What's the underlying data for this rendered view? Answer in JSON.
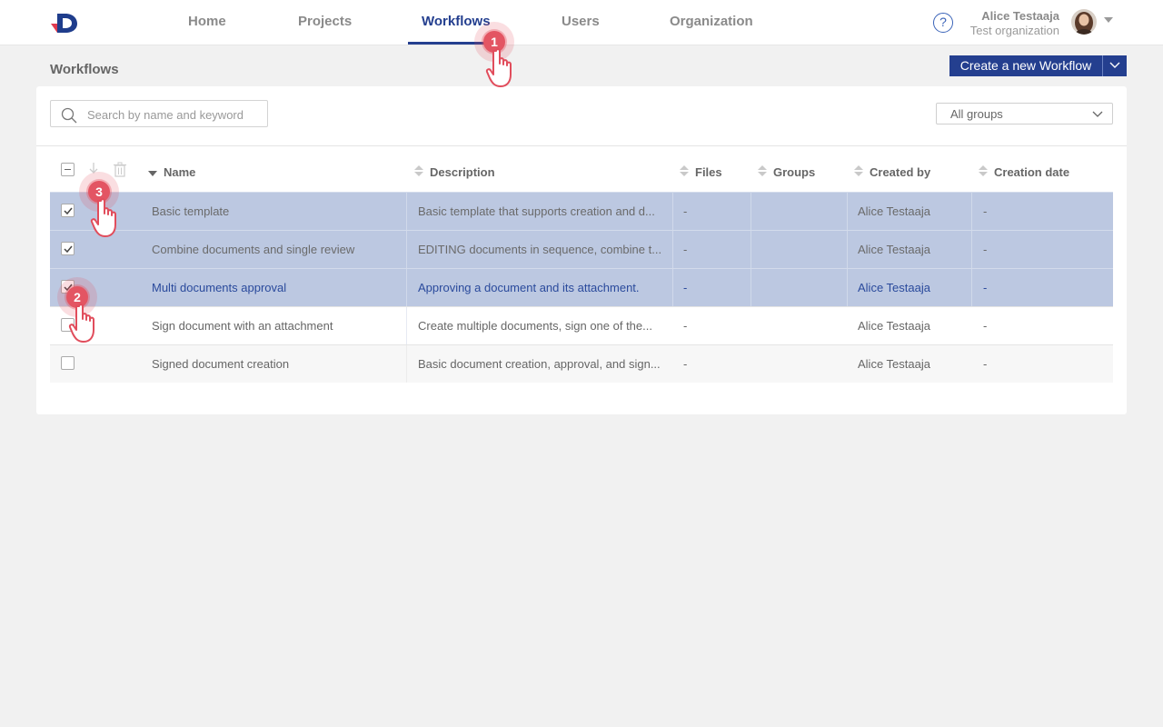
{
  "nav": {
    "items": [
      {
        "label": "Home",
        "active": false
      },
      {
        "label": "Projects",
        "active": false
      },
      {
        "label": "Workflows",
        "active": true
      },
      {
        "label": "Users",
        "active": false
      },
      {
        "label": "Organization",
        "active": false
      }
    ],
    "help_icon": "question-circle-icon"
  },
  "user": {
    "name": "Alice Testaaja",
    "organization": "Test organization"
  },
  "page": {
    "title": "Workflows",
    "create_button": "Create a new Workflow"
  },
  "toolbar": {
    "search_placeholder": "Search by name and keyword",
    "groups_filter": "All groups"
  },
  "table": {
    "columns": [
      "Name",
      "Description",
      "Files",
      "Groups",
      "Created by",
      "Creation date"
    ],
    "sorted_column": "Name",
    "rows": [
      {
        "selected": true,
        "name": "Basic template",
        "description": "Basic template that supports creation and d...",
        "files": "-",
        "groups": "",
        "created_by": "Alice Testaaja",
        "creation_date": "-"
      },
      {
        "selected": true,
        "name": "Combine documents and single review",
        "description": "EDITING documents in sequence, combine t...",
        "files": "-",
        "groups": "",
        "created_by": "Alice Testaaja",
        "creation_date": "-"
      },
      {
        "selected": true,
        "name": "Multi documents approval",
        "description": "Approving a document and its attachment.",
        "files": "-",
        "groups": "",
        "created_by": "Alice Testaaja",
        "creation_date": "-"
      },
      {
        "selected": false,
        "name": "Sign document with an attachment",
        "description": "Create multiple documents, sign one of the...",
        "files": "-",
        "groups": "",
        "created_by": "Alice Testaaja",
        "creation_date": "-"
      },
      {
        "selected": false,
        "name": "Signed document creation",
        "description": "Basic document creation, approval, and sign...",
        "files": "-",
        "groups": "",
        "created_by": "Alice Testaaja",
        "creation_date": "-"
      }
    ]
  },
  "callouts": [
    "1",
    "2",
    "3"
  ],
  "colors": {
    "brand": "#243f8f",
    "selected_row": "#bcc8e1",
    "callout": "#e35563"
  }
}
